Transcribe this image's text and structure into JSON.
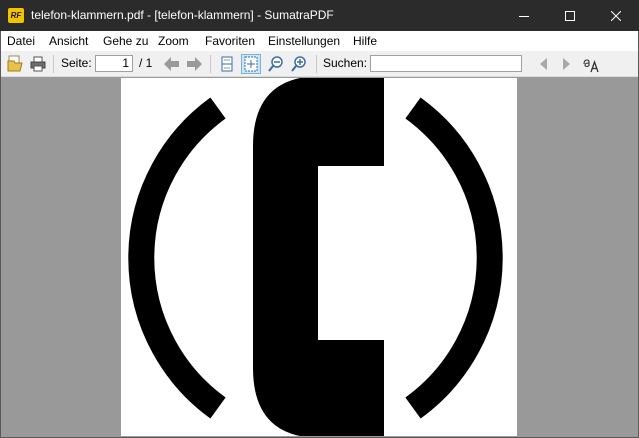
{
  "window": {
    "title": "telefon-klammern.pdf - [telefon-klammern] - SumatraPDF",
    "logo_text": "RF"
  },
  "menu": {
    "items": [
      "Datei",
      "Ansicht",
      "Gehe zu",
      "Zoom",
      "Favoriten",
      "Einstellungen",
      "Hilfe"
    ]
  },
  "toolbar": {
    "page_label": "Seite:",
    "page_value": "1",
    "page_total": "/ 1",
    "search_label": "Suchen:",
    "search_value": "",
    "fit_page_active": true
  },
  "icons": {
    "open": "open-folder-icon",
    "print": "printer-icon",
    "prev_page": "arrow-left-icon",
    "next_page": "arrow-right-icon",
    "fit_width": "fit-width-icon",
    "fit_page": "fit-page-icon",
    "zoom_out": "zoom-out-icon",
    "zoom_in": "zoom-in-icon",
    "find_prev": "triangle-left-icon",
    "find_next": "triangle-right-icon",
    "match_case": "match-case-icon"
  },
  "colors": {
    "titlebar_bg": "#2b2b2b",
    "toolbar_bg": "#f0f0f0",
    "canvas_bg": "#999999",
    "page_bg": "#ffffff",
    "ink": "#000000",
    "logo": "#f2c200"
  }
}
